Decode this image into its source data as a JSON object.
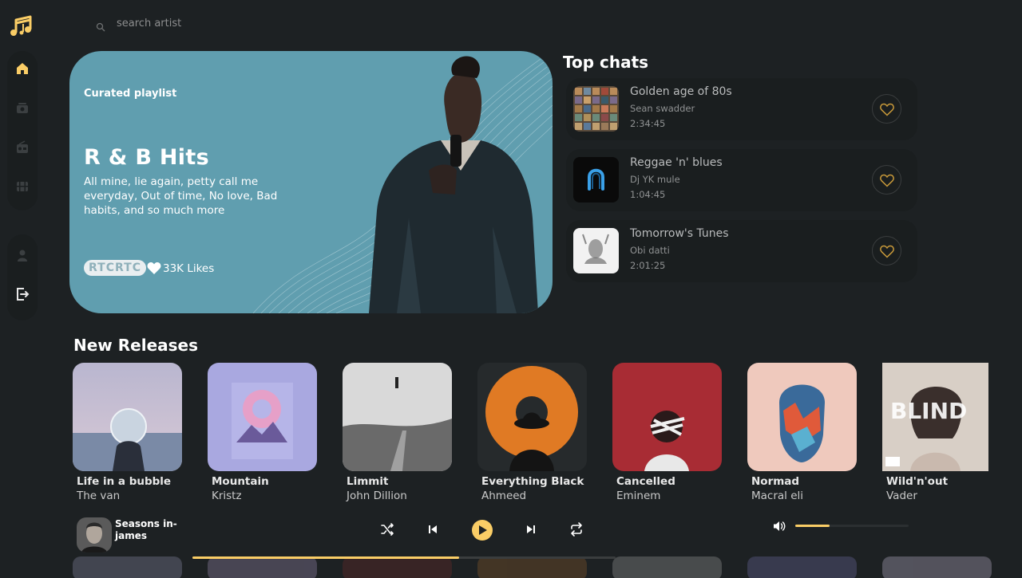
{
  "app": {
    "logo_icon": "music-note-icon",
    "accent_color": "#facd66",
    "background_color": "#1d2123"
  },
  "sidebar": {
    "items": [
      {
        "name": "home",
        "icon": "home-icon",
        "active": true
      },
      {
        "name": "collections",
        "icon": "collection-icon",
        "active": false
      },
      {
        "name": "radio",
        "icon": "radio-icon",
        "active": false
      },
      {
        "name": "videos",
        "icon": "video-icon",
        "active": false
      },
      {
        "name": "profile",
        "icon": "profile-icon",
        "active": false
      },
      {
        "name": "logout",
        "icon": "logout-icon",
        "active": false
      }
    ]
  },
  "search": {
    "placeholder": "search artist",
    "icon": "search-icon"
  },
  "hero": {
    "label": "Curated playlist",
    "title": "R & B Hits",
    "description": "All mine, lie again, petty call me everyday, Out of time, No love, Bad habits, and so much more",
    "avatars_text": "RTCRTC",
    "likes": "33K Likes",
    "background_color": "#609eaf"
  },
  "top_charts": {
    "title": "Top chats",
    "items": [
      {
        "title": "Golden age of 80s",
        "artist": "Sean swadder",
        "duration": "2:34:45"
      },
      {
        "title": "Reggae 'n' blues",
        "artist": "Dj YK mule",
        "duration": "1:04:45"
      },
      {
        "title": "Tomorrow's Tunes",
        "artist": "Obi datti",
        "duration": "2:01:25"
      }
    ]
  },
  "new_releases": {
    "title": "New Releases",
    "items": [
      {
        "title": "Life in a bubble",
        "artist": "The van"
      },
      {
        "title": "Mountain",
        "artist": "Kristz"
      },
      {
        "title": "Limmit",
        "artist": "John Dillion"
      },
      {
        "title": "Everything Black",
        "artist": "Ahmeed"
      },
      {
        "title": "Cancelled",
        "artist": "Eminem"
      },
      {
        "title": "Normad",
        "artist": "Macral eli"
      },
      {
        "title": "Wild'n'out",
        "artist": "Vader"
      }
    ]
  },
  "player": {
    "now_playing": "Seasons in-james",
    "progress_percent": 63,
    "volume_percent": 30,
    "controls": [
      "shuffle-icon",
      "previous-icon",
      "play-icon",
      "next-icon",
      "repeat-icon"
    ]
  }
}
